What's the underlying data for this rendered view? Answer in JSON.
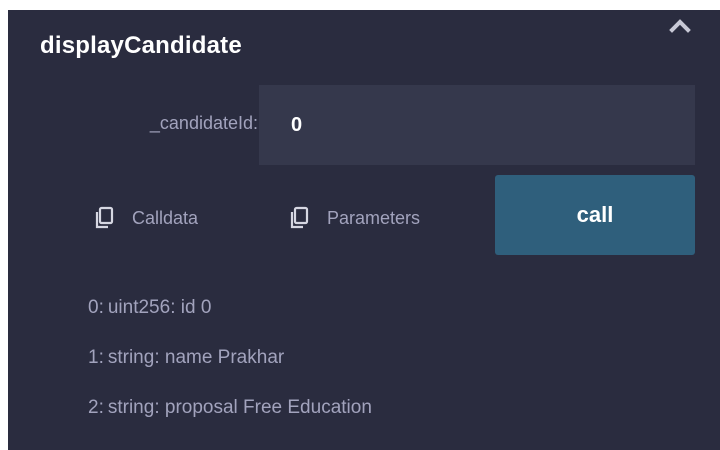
{
  "function": {
    "name": "displayCandidate",
    "collapse_icon": "chevron-up-icon"
  },
  "parameter": {
    "label": "_candidateId:",
    "value": "0"
  },
  "actions": {
    "calldata_label": "Calldata",
    "parameters_label": "Parameters",
    "call_label": "call",
    "copy_icon": "copy-icon"
  },
  "results": [
    {
      "index": "0:",
      "text": "uint256: id 0"
    },
    {
      "index": "1:",
      "text": "string: name Prakhar"
    },
    {
      "index": "2:",
      "text": "string: proposal Free Education"
    }
  ],
  "colors": {
    "panel_bg": "#2a2c3f",
    "input_bg": "#35384c",
    "call_button_bg": "#2f5f7c",
    "muted_text": "#a2a3bd",
    "bright_text": "#ffffff"
  }
}
